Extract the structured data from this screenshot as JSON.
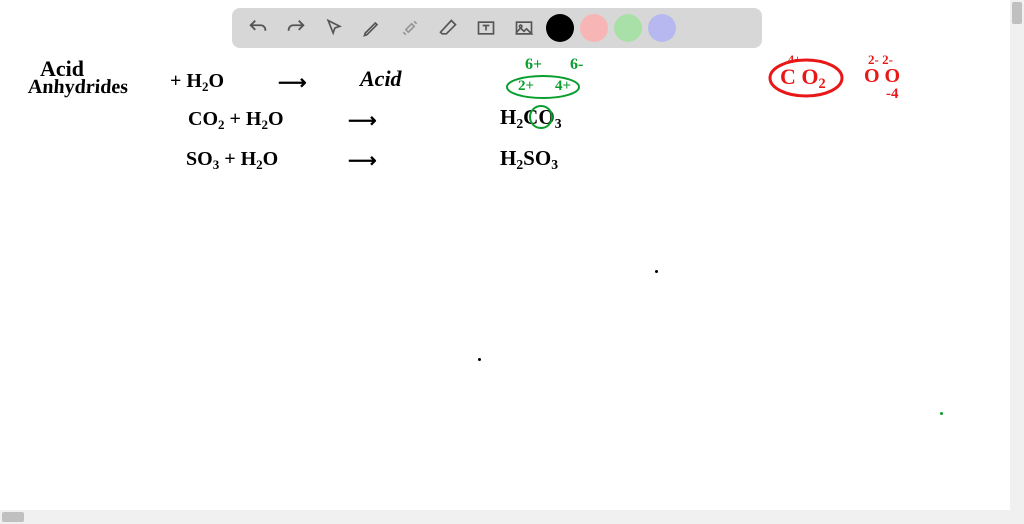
{
  "toolbar": {
    "tools": [
      "undo",
      "redo",
      "pointer",
      "pencil",
      "wrench",
      "eraser",
      "textbox",
      "image"
    ],
    "colors": [
      "black",
      "red",
      "green",
      "purple"
    ]
  },
  "notes": {
    "title_line1": "Acid",
    "title_line2": "Anhydrides",
    "plus_h2o_1": "+ H₂O",
    "arrow": "→",
    "acid_label": "Acid",
    "eq2_left": "CO₂ + H₂O",
    "eq2_right_h2": "H₂",
    "eq2_right_c": "C",
    "eq2_right_o3": "O₃",
    "eq3_left": "SO₃ + H₂O",
    "eq3_right": "H₂SO₃",
    "green_top_left": "6+",
    "green_top_right": "6-",
    "green_mid_left": "2+",
    "green_mid_right": "4+",
    "red_co2_c": "C",
    "red_co2_top": "4+",
    "red_co2_o2": "O₂",
    "red_right_top": "2- 2-",
    "red_right_o": "O O",
    "red_right_bottom": "-4"
  }
}
